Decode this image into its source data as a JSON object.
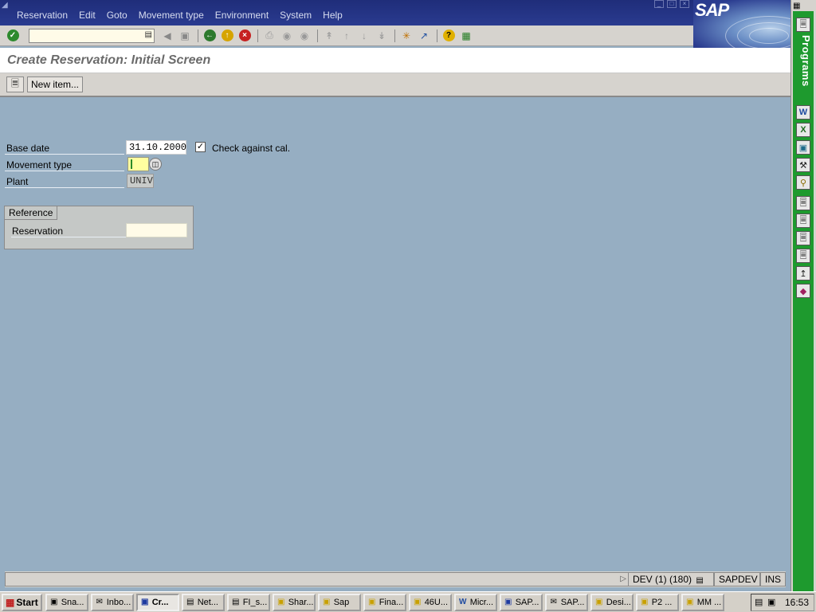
{
  "menu": {
    "items": [
      "Reservation",
      "Edit",
      "Goto",
      "Movement type",
      "Environment",
      "System",
      "Help"
    ]
  },
  "logo": {
    "text": "SAP"
  },
  "toolbar": {
    "command_value": ""
  },
  "title": "Create Reservation: Initial Screen",
  "app_toolbar": {
    "new_item_label": "New item..."
  },
  "form": {
    "base_date_label": "Base date",
    "base_date_value": "31.10.2000",
    "check_label": "Check against cal.",
    "check_checked": true,
    "movement_type_label": "Movement type",
    "movement_type_value": "",
    "plant_label": "Plant",
    "plant_value": "UNIV"
  },
  "reference": {
    "tab_label": "Reference",
    "reservation_label": "Reservation",
    "reservation_value": ""
  },
  "status": {
    "message": "",
    "system": "DEV (1) (180)",
    "server": "SAPDEV",
    "mode": "INS"
  },
  "sidebar": {
    "title": "Programs"
  },
  "taskbar": {
    "start_label": "Start",
    "tasks": [
      "Sna...",
      "Inbo...",
      "Cr...",
      "Net...",
      "FI_s...",
      "Shar...",
      "Sap",
      "Fina...",
      "46U...",
      "Micr...",
      "SAP...",
      "SAP...",
      "Desi...",
      "P2 ...",
      "MM ..."
    ],
    "clock": "16:53"
  },
  "colors": {
    "menubar": "#1f2d7a",
    "workarea": "#96aec2",
    "required_field": "#ffffa0",
    "sidebar_green": "#1e9a2e"
  }
}
